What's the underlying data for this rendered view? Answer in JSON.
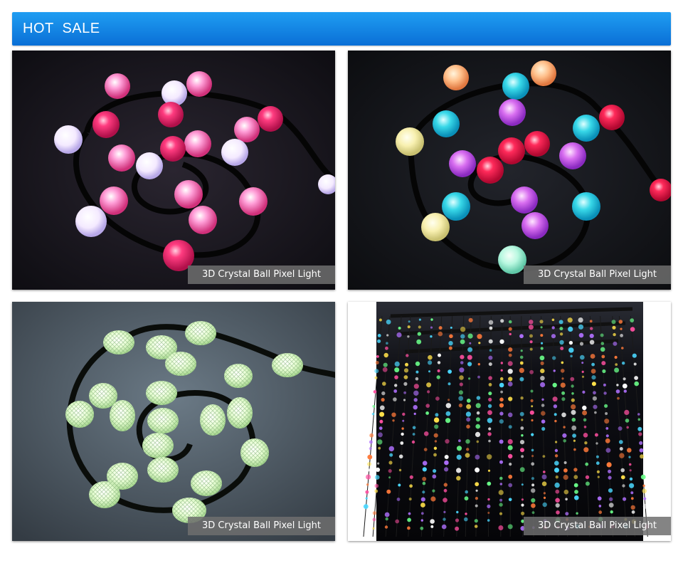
{
  "header": {
    "title": "HOT  SALE"
  },
  "products": [
    {
      "caption": "3D Crystal Ball Pixel Light",
      "image_icon": "rgb-ball-string-photo"
    },
    {
      "caption": "3D Crystal Ball Pixel Light",
      "image_icon": "multicolor-ball-string-photo"
    },
    {
      "caption": "3D Crystal Ball Pixel Light",
      "image_icon": "warm-white-crystal-ball-string-photo"
    },
    {
      "caption": "3D Crystal Ball Pixel Light",
      "image_icon": "led-cube-installation-photo"
    }
  ],
  "colors": {
    "header_top": "#1f9df2",
    "header_bottom": "#0a6fd6",
    "caption_bg": "#6e6e6e",
    "caption_text": "#ffffff"
  }
}
